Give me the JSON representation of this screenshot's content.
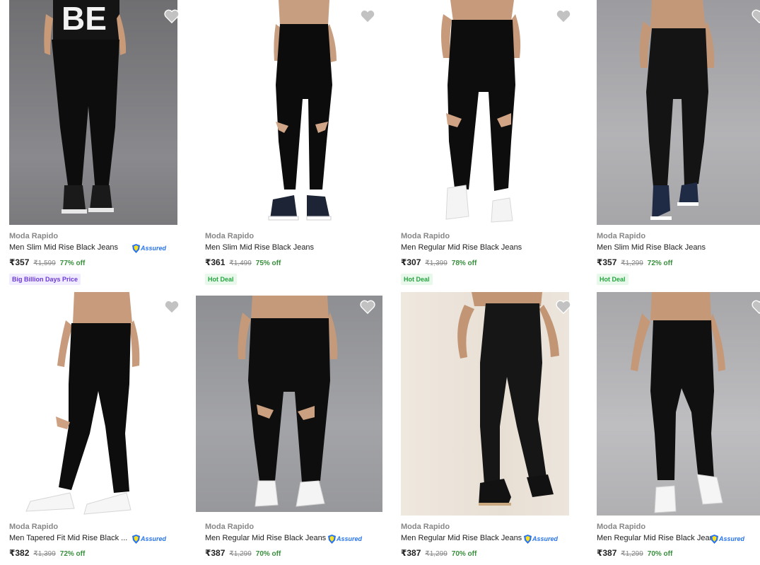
{
  "colors": {
    "accent": "#2874f0",
    "discount": "#388e3c",
    "hot_deal": "#26a541",
    "bbd": "#6b3ad8"
  },
  "icons": {
    "wishlist": "heart-icon",
    "assured": "flipkart-assured-badge"
  },
  "assured_label": "Assured",
  "products": [
    {
      "brand": "Moda Rapido",
      "title": "Men Slim Mid Rise Black Jeans",
      "price": "₹357",
      "mrp": "₹1,599",
      "off": "77% off",
      "tag": "Big Billion Days Price",
      "assured": true
    },
    {
      "brand": "Moda Rapido",
      "title": "Men Slim Mid Rise Black Jeans",
      "price": "₹361",
      "mrp": "₹1,499",
      "off": "75% off",
      "tag": "Hot Deal",
      "assured": false
    },
    {
      "brand": "Moda Rapido",
      "title": "Men Regular Mid Rise Black Jeans",
      "price": "₹307",
      "mrp": "₹1,399",
      "off": "78% off",
      "tag": "Hot Deal",
      "assured": false
    },
    {
      "brand": "Moda Rapido",
      "title": "Men Slim Mid Rise Black Jeans",
      "price": "₹357",
      "mrp": "₹1,299",
      "off": "72% off",
      "tag": "Hot Deal",
      "assured": false
    },
    {
      "brand": "Moda Rapido",
      "title": "Men Tapered Fit Mid Rise Black ...",
      "price": "₹382",
      "mrp": "₹1,399",
      "off": "72% off",
      "tag": "",
      "assured": true
    },
    {
      "brand": "Moda Rapido",
      "title": "Men Regular Mid Rise Black Jeans",
      "price": "₹387",
      "mrp": "₹1,299",
      "off": "70% off",
      "tag": "",
      "assured": true
    },
    {
      "brand": "Moda Rapido",
      "title": "Men Regular Mid Rise Black Jeans",
      "price": "₹387",
      "mrp": "₹1,299",
      "off": "70% off",
      "tag": "",
      "assured": true
    },
    {
      "brand": "Moda Rapido",
      "title": "Men Regular Mid Rise Black Jeans",
      "price": "₹387",
      "mrp": "₹1,299",
      "off": "70% off",
      "tag": "",
      "assured": true
    }
  ]
}
